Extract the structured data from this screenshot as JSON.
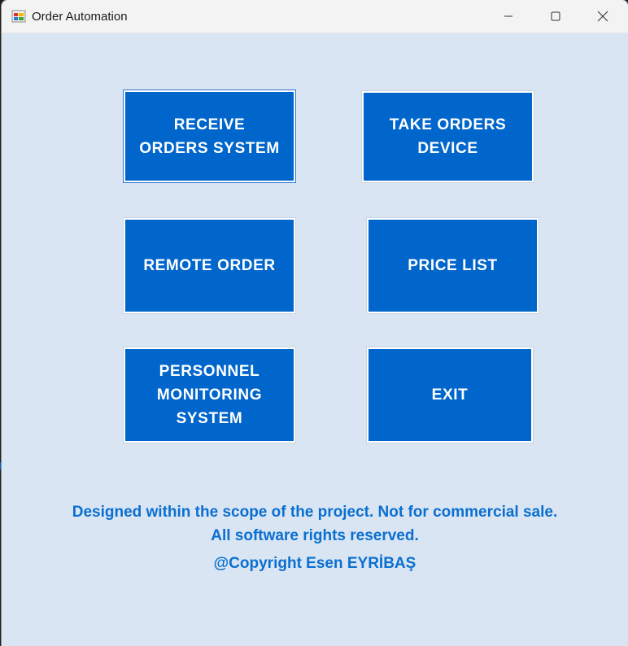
{
  "window": {
    "title": "Order Automation",
    "minimize_label": "Minimize",
    "maximize_label": "Maximize",
    "close_label": "Close"
  },
  "buttons": {
    "receive_orders": "RECEIVE\nORDERS SYSTEM",
    "take_orders_device": "TAKE ORDERS\nDEVICE",
    "remote_order": "REMOTE ORDER",
    "price_list": "PRICE LIST",
    "personnel_monitoring": "PERSONNEL\nMONITORING\nSYSTEM",
    "exit": "EXIT"
  },
  "footer": {
    "line1": "Designed within the scope of the project. Not for commercial sale.",
    "line2": "All software rights reserved.",
    "line3": "@Copyright Esen EYRİBAŞ"
  },
  "colors": {
    "tile_blue": "#0066cc",
    "background": "#d9e5f3",
    "footer_text": "#0a6fd0"
  }
}
